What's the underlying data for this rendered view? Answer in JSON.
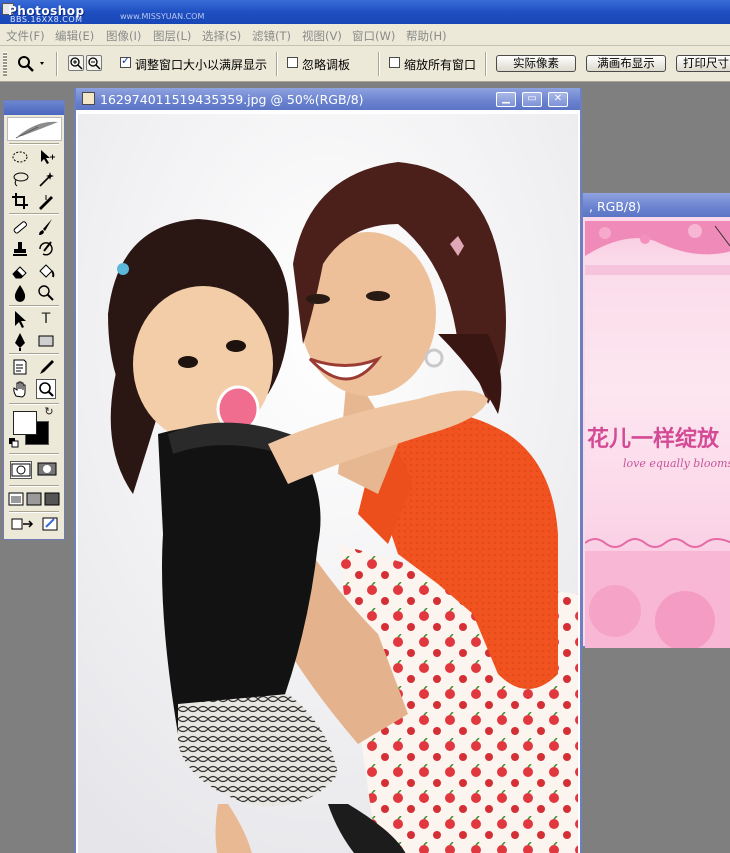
{
  "app": {
    "title": "Photoshop",
    "watermark": "BBS.16XX8.COM",
    "watermark_site": "www.MISSYUAN.COM"
  },
  "menu": [
    {
      "label": "文件(F)"
    },
    {
      "label": "编辑(E)"
    },
    {
      "label": "图像(I)"
    },
    {
      "label": "图层(L)"
    },
    {
      "label": "选择(S)"
    },
    {
      "label": "滤镜(T)"
    },
    {
      "label": "视图(V)"
    },
    {
      "label": "窗口(W)"
    },
    {
      "label": "帮助(H)"
    }
  ],
  "options": {
    "resize_windows_label": "调整窗口大小以满屏显示",
    "resize_windows_checked": true,
    "ignore_palettes_label": "忽略调板",
    "ignore_palettes_checked": false,
    "zoom_all_label": "缩放所有窗口",
    "zoom_all_checked": false,
    "actual_pixels_label": "实际像素",
    "fit_on_screen_label": "满画布显示",
    "print_size_label": "打印尺寸"
  },
  "document": {
    "title": "162974011519435359.jpg @ 50%(RGB/8)",
    "minimize": "▁",
    "maximize": "▭",
    "close": "✕"
  },
  "document2": {
    "title": ", RGB/8)",
    "canvas_text": "花儿一样绽放",
    "canvas_subtext": "love equally blooms like th"
  },
  "colors": {
    "foreground": "#ffffff",
    "background": "#000000",
    "titlebar": "#1f4fc2",
    "doc_titlebar": "#6a82cf"
  }
}
